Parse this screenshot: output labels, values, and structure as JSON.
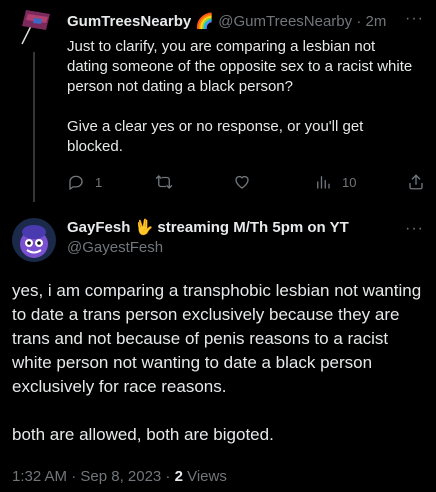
{
  "reply_tweet": {
    "display_name": "GumTreesNearby",
    "name_emoji": "🌈",
    "handle": "@GumTreesNearby",
    "separator": "·",
    "time": "2m",
    "more_label": "···",
    "text": "Just to clarify, you are comparing a lesbian not dating someone of the opposite sex to a racist white person not dating a black person?\n\nGive a clear yes or no response, or you'll get blocked.",
    "actions": {
      "reply_icon": "reply-icon",
      "reply_count": "1",
      "retweet_icon": "retweet-icon",
      "like_icon": "heart-icon",
      "views_icon": "views-bar-icon",
      "views_count": "10",
      "share_icon": "share-icon"
    }
  },
  "main_tweet": {
    "display_name": "GayFesh 🖖 streaming M/Th 5pm on YT",
    "handle": "@GayestFesh",
    "more_label": "···",
    "text": "yes, i am comparing a transphobic lesbian not wanting to date a trans person exclusively because they are trans and not because of penis reasons to a racist white person not wanting to date a black person exclusively for race reasons.\n\nboth are allowed, both are bigoted.",
    "timestamp": "1:32 AM · Sep 8, 2023 · ",
    "views_count": "2",
    "views_label": " Views"
  },
  "colors": {
    "background": "#000000",
    "primary_text": "#e7e9ea",
    "secondary_text": "#71767b",
    "divider": "#333639"
  }
}
